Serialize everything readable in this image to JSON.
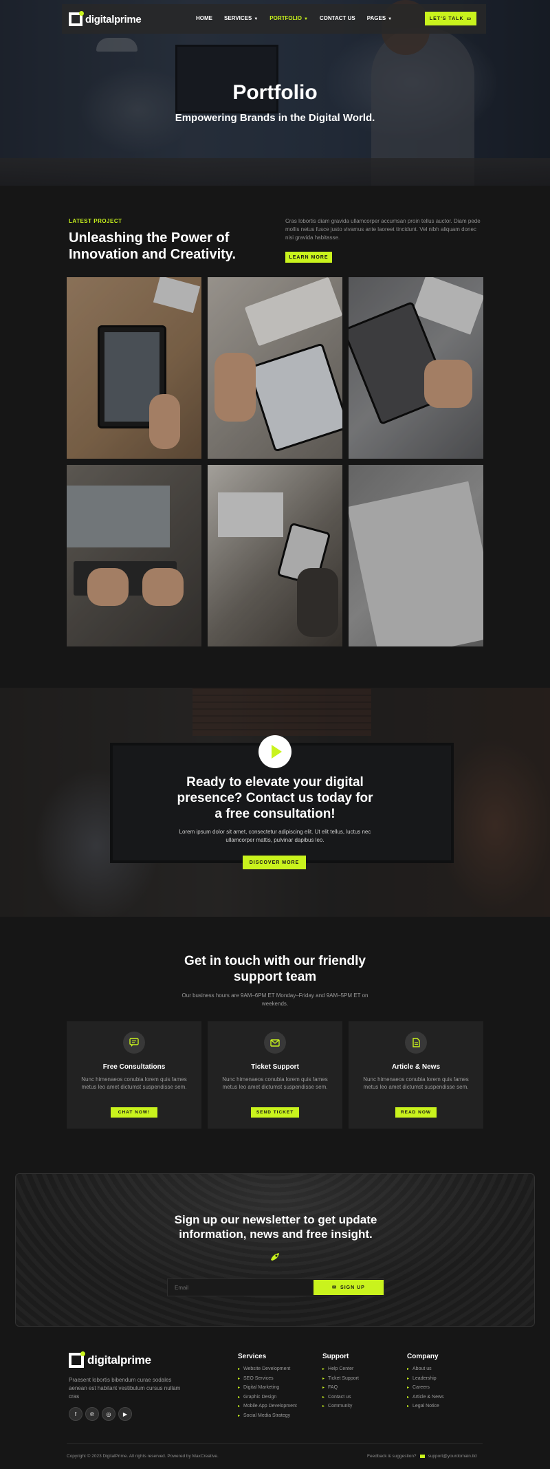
{
  "brand": {
    "logo_text": "digitalprime",
    "accent": "#c9f31d",
    "background": "#161616"
  },
  "nav": {
    "items": [
      {
        "label": "HOME",
        "dropdown": false,
        "active": false
      },
      {
        "label": "SERVICES",
        "dropdown": true,
        "active": false
      },
      {
        "label": "PORTFOLIO",
        "dropdown": true,
        "active": true
      },
      {
        "label": "CONTACT US",
        "dropdown": false,
        "active": false
      },
      {
        "label": "PAGES",
        "dropdown": true,
        "active": false
      }
    ],
    "cta_label": "LET'S TALK",
    "cta_icon": "chat-icon"
  },
  "hero": {
    "title": "Portfolio",
    "subtitle": "Empowering Brands in the Digital World."
  },
  "latest_project": {
    "kicker": "LATEST PROJECT",
    "title": "Unleashing the Power of Innovation and Creativity.",
    "description": "Cras lobortis diam gravida ullamcorper accumsan proin tellus auctor. Diam pede mollis netus fusce justo vivamus ante laoreet tincidunt. Vel nibh aliquam donec nisi gravida habitasse.",
    "button": "LEARN MORE",
    "gallery": [
      "tablet-on-desk-photo",
      "tablet-wireframe-photo",
      "tablet-music-app-photo",
      "laptop-typing-photo",
      "designer-with-tablet-photo",
      "wireframe-sketch-photo"
    ]
  },
  "cta": {
    "play_icon": "play-icon",
    "title": "Ready to elevate your digital presence? Contact us today for a free consultation!",
    "description": "Lorem ipsum dolor sit amet, consectetur adipiscing elit. Ut elit tellus, luctus nec ullamcorper mattis, pulvinar dapibus leo.",
    "button": "DISCOVER MORE"
  },
  "contact": {
    "title": "Get in touch with our friendly support team",
    "subtitle": "Our business hours are 9AM–6PM ET Monday–Friday and 9AM–5PM ET on weekends.",
    "cards": [
      {
        "icon": "chat-bubble-icon",
        "title": "Free Consultations",
        "text": "Nunc himenaeos conubia lorem quis fames metus leo amet dictumst suspendisse sem.",
        "button": "CHAT NOW!"
      },
      {
        "icon": "envelope-icon",
        "title": "Ticket Support",
        "text": "Nunc himenaeos conubia lorem quis fames metus leo amet dictumst suspendisse sem.",
        "button": "SEND TICKET"
      },
      {
        "icon": "document-icon",
        "title": "Article & News",
        "text": "Nunc himenaeos conubia lorem quis fames metus leo amet dictumst suspendisse sem.",
        "button": "READ NOW"
      }
    ]
  },
  "newsletter": {
    "title": "Sign up our newsletter to get update information, news and free insight.",
    "icon": "rocket-icon",
    "placeholder": "Email",
    "button": "SIGN UP",
    "button_icon": "envelope-icon"
  },
  "footer": {
    "logo_text": "digitalprime",
    "description": "Praesent lobortis bibendum curae sodales aenean est habitant vestibulum cursus nullam cras",
    "socials": [
      "facebook-icon",
      "pinterest-icon",
      "instagram-icon",
      "youtube-icon"
    ],
    "columns": [
      {
        "title": "Services",
        "links": [
          "Website Development",
          "SEO Services",
          "Digital Marketing",
          "Graphic Design",
          "Mobile App Development",
          "Social Media Strategy"
        ]
      },
      {
        "title": "Support",
        "links": [
          "Help Center",
          "Ticket Support",
          "FAQ",
          "Contact us",
          "Community"
        ]
      },
      {
        "title": "Company",
        "links": [
          "About us",
          "Leadership",
          "Careers",
          "Article & News",
          "Legal Notice"
        ]
      }
    ],
    "copyright": "Copyright © 2023 DigitalPrime. All rights reserved. Powered by MaxCreative.",
    "support_label": "Feedback & suggestion?",
    "support_email": "support@yourdomain.tld"
  }
}
